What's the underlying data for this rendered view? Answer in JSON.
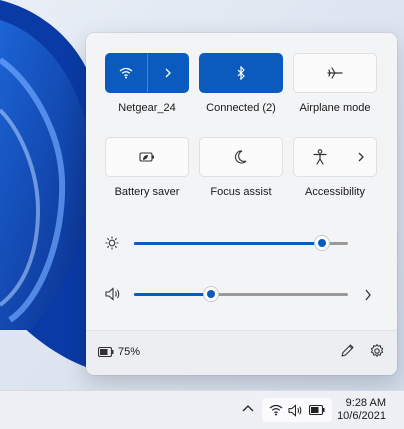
{
  "quick_settings": {
    "tiles": [
      {
        "id": "wifi",
        "label": "Netgear_24",
        "active": true,
        "icon": "wifi-icon",
        "has_chevron": true
      },
      {
        "id": "bluetooth",
        "label": "Connected (2)",
        "active": true,
        "icon": "bluetooth-icon",
        "has_chevron": false
      },
      {
        "id": "airplane",
        "label": "Airplane mode",
        "active": false,
        "icon": "airplane-icon",
        "has_chevron": false
      },
      {
        "id": "battery_saver",
        "label": "Battery saver",
        "active": false,
        "icon": "battery-saver-icon",
        "has_chevron": false
      },
      {
        "id": "focus",
        "label": "Focus assist",
        "active": false,
        "icon": "moon-icon",
        "has_chevron": false
      },
      {
        "id": "accessibility",
        "label": "Accessibility",
        "active": false,
        "icon": "accessibility-icon",
        "has_chevron": true
      }
    ],
    "brightness": {
      "value": 0.88,
      "icon": "brightness-icon"
    },
    "volume": {
      "value": 0.36,
      "icon": "speaker-icon",
      "has_chevron": true
    },
    "battery": {
      "percent": "75%",
      "icon": "battery-icon"
    },
    "footer_icons": [
      "edit-pencil-icon",
      "settings-gear-icon"
    ]
  },
  "taskbar": {
    "time": "9:28 AM",
    "date": "10/6/2021",
    "tray_icons": [
      "chevron-up-icon",
      "wifi-icon",
      "speaker-icon",
      "battery-icon"
    ]
  },
  "colors": {
    "accent": "#0a5bbd",
    "track": "#9a9a9a"
  }
}
